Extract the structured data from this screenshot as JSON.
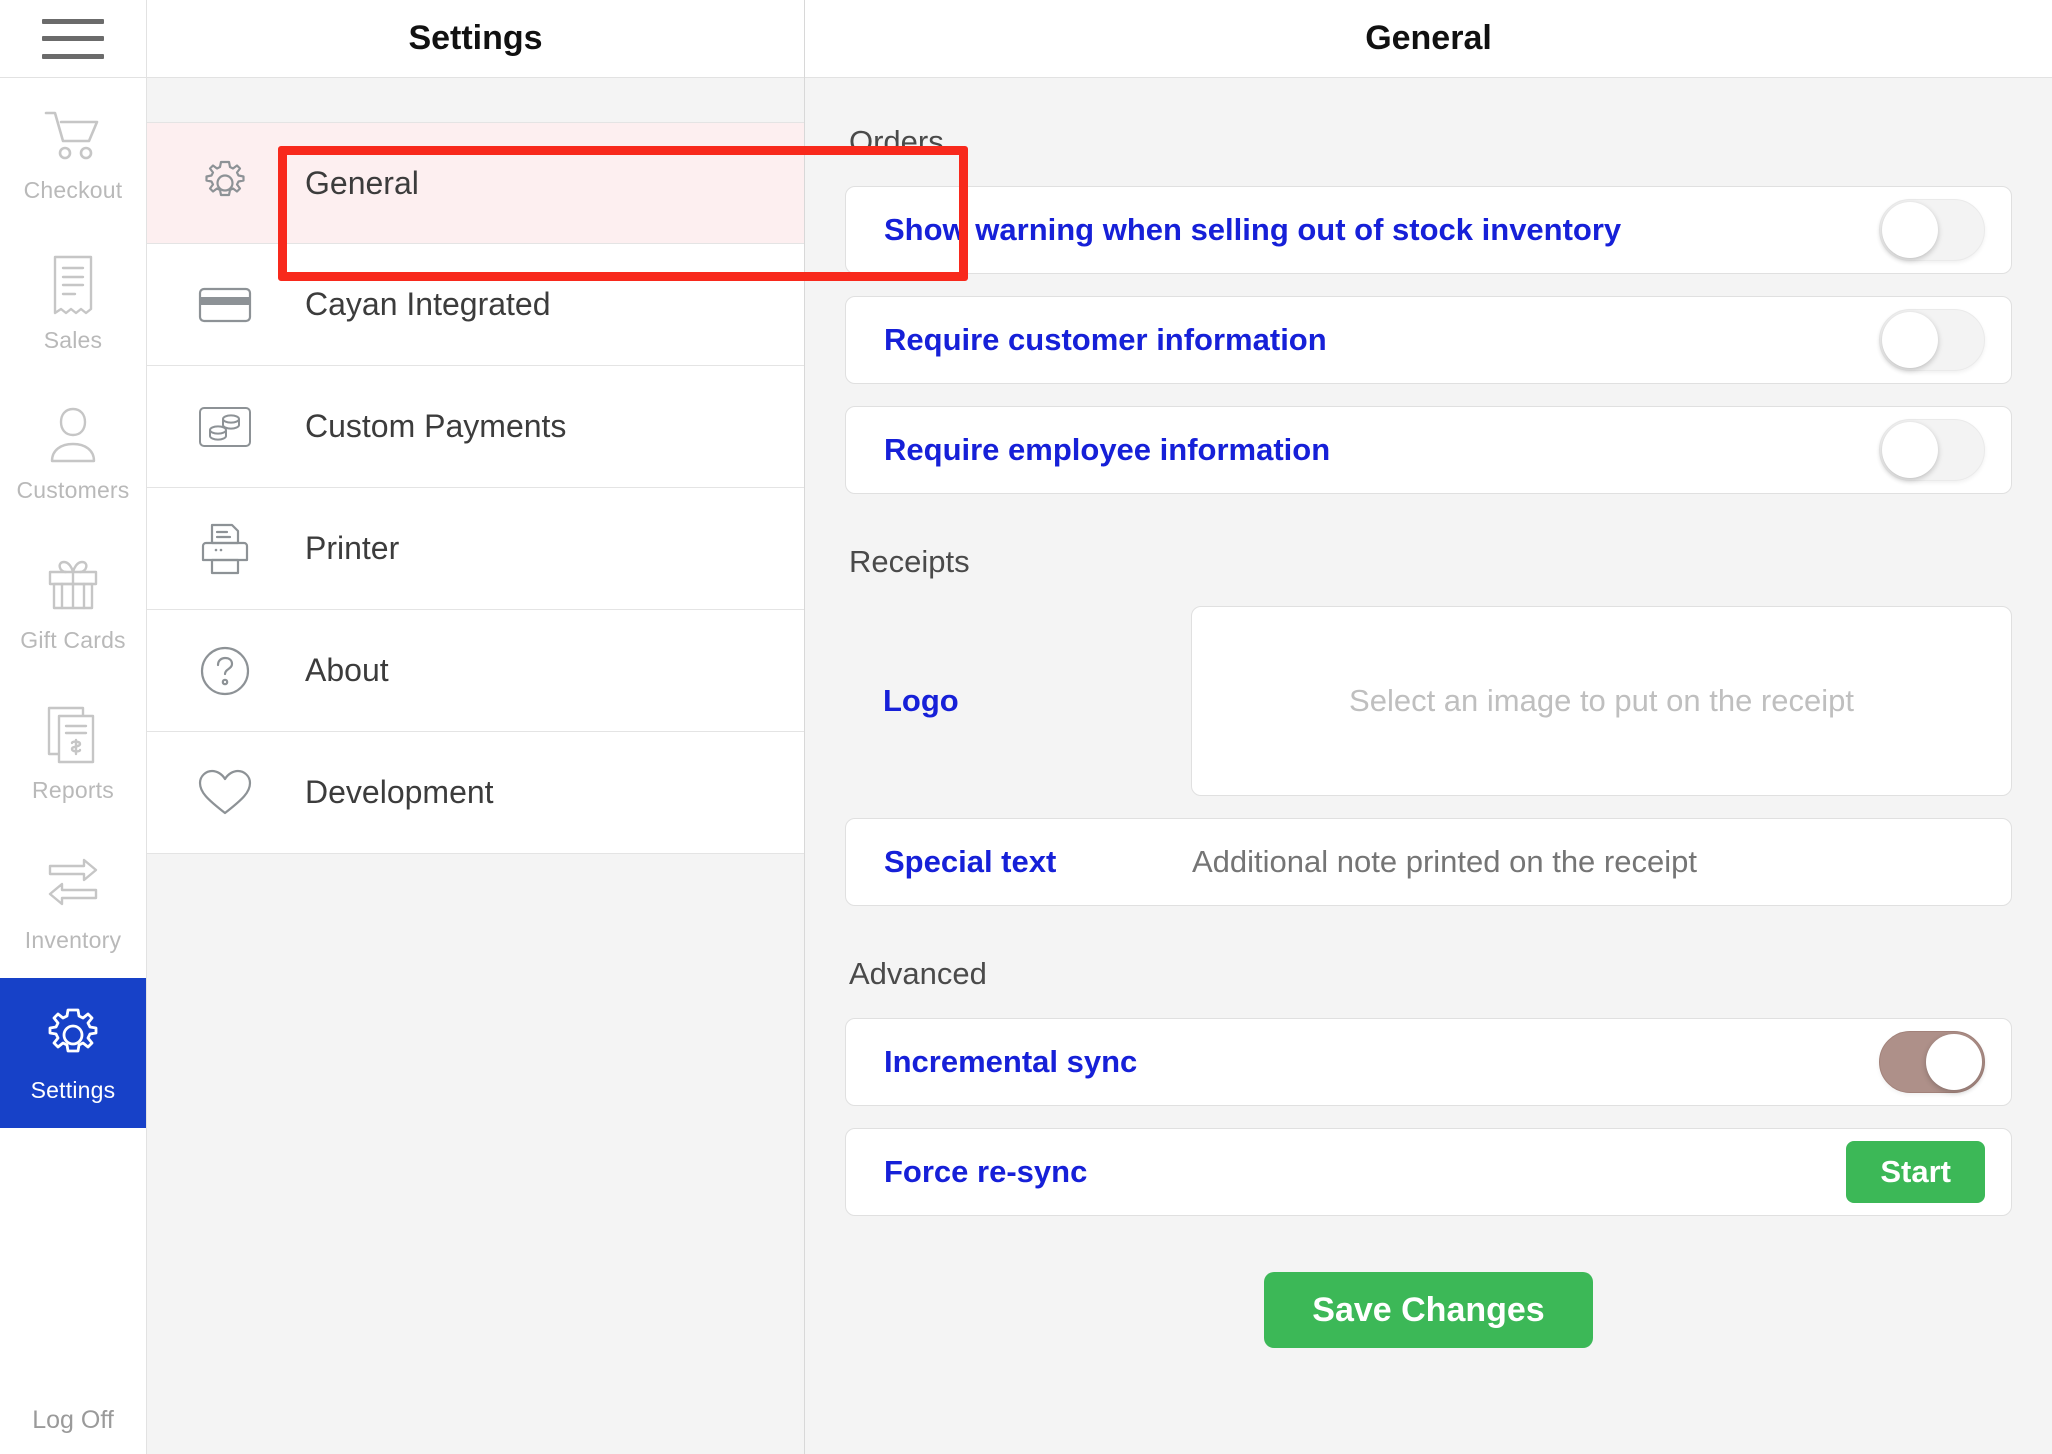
{
  "nav": {
    "menu_icon": "hamburger-icon",
    "items": [
      {
        "label": "Checkout",
        "icon": "shopping-cart-icon",
        "active": false
      },
      {
        "label": "Sales",
        "icon": "receipt-icon",
        "active": false
      },
      {
        "label": "Customers",
        "icon": "person-icon",
        "active": false
      },
      {
        "label": "Gift Cards",
        "icon": "gift-icon",
        "active": false
      },
      {
        "label": "Reports",
        "icon": "documents-dollar-icon",
        "active": false
      },
      {
        "label": "Inventory",
        "icon": "exchange-arrows-icon",
        "active": false
      },
      {
        "label": "Settings",
        "icon": "gear-icon",
        "active": true
      }
    ],
    "logoff_label": "Log Off",
    "active_color": "#1741c8"
  },
  "settings_panel": {
    "title": "Settings",
    "items": [
      {
        "label": "General",
        "icon": "gear-icon",
        "selected": true
      },
      {
        "label": "Cayan Integrated",
        "icon": "credit-card-icon",
        "selected": false
      },
      {
        "label": "Custom Payments",
        "icon": "coins-icon",
        "selected": false
      },
      {
        "label": "Printer",
        "icon": "printer-icon",
        "selected": false
      },
      {
        "label": "About",
        "icon": "question-mark-circle-icon",
        "selected": false
      },
      {
        "label": "Development",
        "icon": "heart-icon",
        "selected": false
      }
    ],
    "highlight_color": "#f8291c",
    "selected_row_bg": "#fdeff0"
  },
  "main": {
    "title": "General",
    "sections": {
      "orders": {
        "title": "Orders",
        "rows": [
          {
            "label": "Show warning when selling out of stock inventory",
            "toggle": "off"
          },
          {
            "label": "Require customer information",
            "toggle": "off"
          },
          {
            "label": "Require employee information",
            "toggle": "off"
          }
        ]
      },
      "receipts": {
        "title": "Receipts",
        "logo_label": "Logo",
        "logo_placeholder": "Select an image to put on the receipt",
        "special_text_label": "Special text",
        "special_text_value": "",
        "special_text_placeholder": "Additional note printed on the receipt"
      },
      "advanced": {
        "title": "Advanced",
        "incremental_sync_label": "Incremental sync",
        "incremental_sync_state": "on",
        "force_resync_label": "Force re-sync",
        "start_button_label": "Start"
      }
    },
    "save_button_label": "Save Changes",
    "accent_green": "#3cb857",
    "link_blue": "#1620d8",
    "toggle_on_color": "#ae9089"
  }
}
